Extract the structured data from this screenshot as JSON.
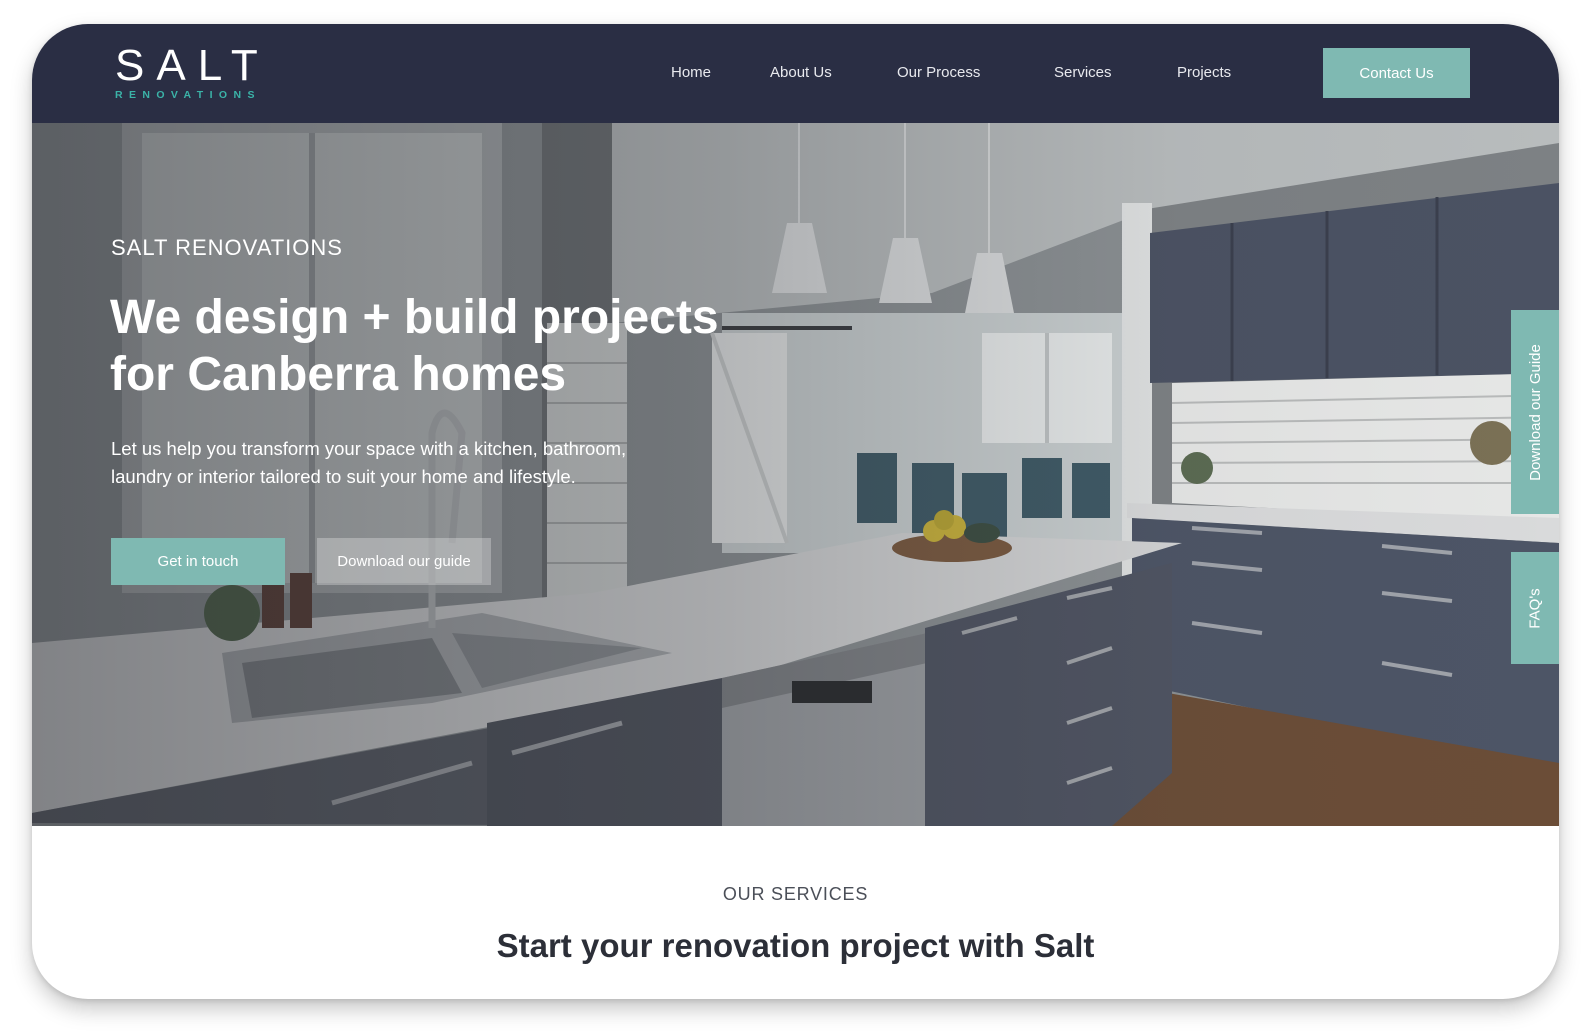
{
  "brand": {
    "name": "SALT",
    "subtitle": "RENOVATIONS",
    "accent_color": "#3bb3a8",
    "nav_bg": "#2a2e44",
    "button_color": "#7fb9b2"
  },
  "nav": {
    "items": [
      {
        "label": "Home"
      },
      {
        "label": "About Us"
      },
      {
        "label": "Our Process"
      },
      {
        "label": "Services"
      },
      {
        "label": "Projects"
      }
    ],
    "cta_label": "Contact Us"
  },
  "hero": {
    "eyebrow": "SALT RENOVATIONS",
    "title_line1": "We design + build projects",
    "title_line2": "for Canberra homes",
    "text_line1": "Let us help you transform your space with a kitchen, bathroom,",
    "text_line2": "laundry or interior tailored to suit your home and lifestyle.",
    "primary_button": "Get in touch",
    "secondary_button": "Download our guide"
  },
  "side_tabs": {
    "guide": "Download our Guide",
    "faq": "FAQ's"
  },
  "services": {
    "eyebrow": "OUR SERVICES",
    "title": "Start your renovation project with Salt"
  }
}
